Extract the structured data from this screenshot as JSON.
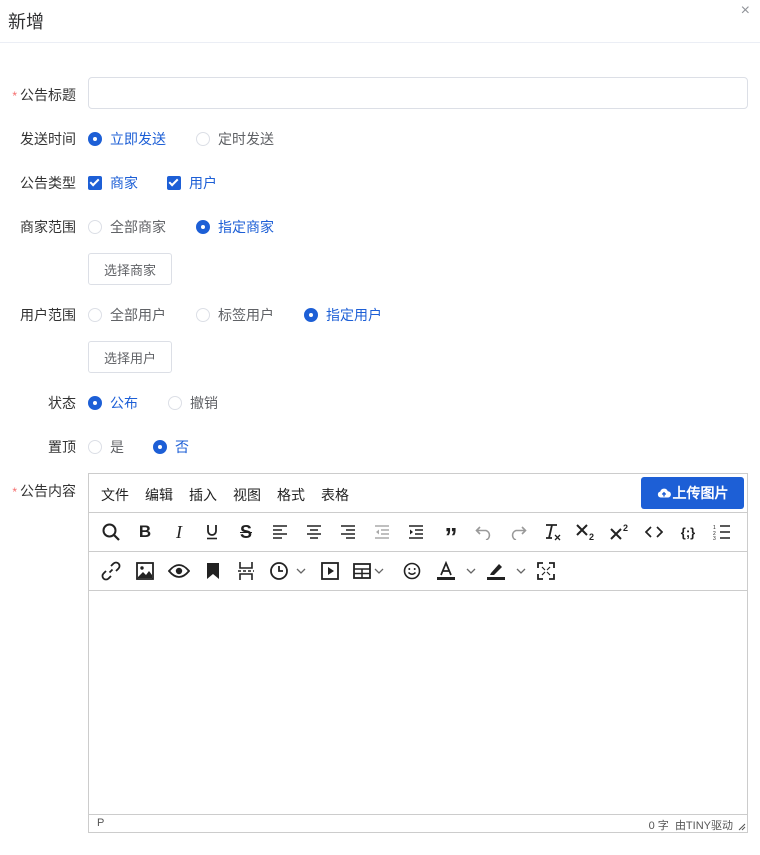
{
  "dialog": {
    "title": "新增",
    "close": "×"
  },
  "fields": {
    "title_label": "公告标题",
    "required_mark": "*",
    "send_time": {
      "label": "发送时间",
      "options": [
        "立即发送",
        "定时发送"
      ],
      "selected": "立即发送"
    },
    "type": {
      "label": "公告类型",
      "options": [
        "商家",
        "用户"
      ],
      "checked": [
        "商家",
        "用户"
      ]
    },
    "merchant_scope": {
      "label": "商家范围",
      "options": [
        "全部商家",
        "指定商家"
      ],
      "selected": "指定商家",
      "button": "选择商家"
    },
    "user_scope": {
      "label": "用户范围",
      "options": [
        "全部用户",
        "标签用户",
        "指定用户"
      ],
      "selected": "指定用户",
      "button": "选择用户"
    },
    "status": {
      "label": "状态",
      "options": [
        "公布",
        "撤销"
      ],
      "selected": "公布"
    },
    "pin": {
      "label": "置顶",
      "options": [
        "是",
        "否"
      ],
      "selected": "否"
    },
    "content_label": "公告内容"
  },
  "editor": {
    "menus": [
      "文件",
      "编辑",
      "插入",
      "视图",
      "格式",
      "表格"
    ],
    "upload_button": "上传图片",
    "status_path": "P",
    "word_count": "0 字",
    "powered_by": "由TINY驱动"
  },
  "colors": {
    "primary": "#1d5fd6",
    "required": "#f56c6c",
    "border": "#dcdfe6"
  }
}
